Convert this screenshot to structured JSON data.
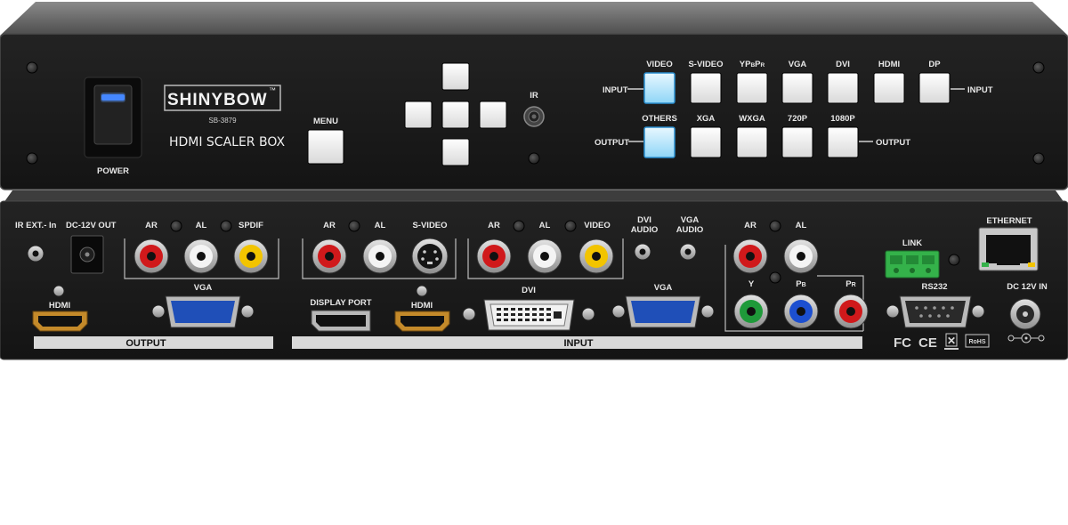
{
  "front": {
    "power_label": "POWER",
    "brand": "SHINYBOW",
    "brand_tm": "™",
    "model": "SB-3879",
    "product_name": "HDMI SCALER BOX",
    "menu_label": "MENU",
    "ir_label": "IR",
    "input_row": {
      "left_label": "INPUT",
      "right_label": "INPUT",
      "buttons": [
        "VIDEO",
        "S-VIDEO",
        "YPBPR",
        "VGA",
        "DVI",
        "HDMI",
        "DP"
      ],
      "ypbpr": {
        "y": "YP",
        "b": "B",
        "p": "P",
        "r": "R"
      },
      "active": "VIDEO"
    },
    "output_row": {
      "left_label": "OUTPUT",
      "right_label": "OUTPUT",
      "buttons": [
        "OTHERS",
        "XGA",
        "WXGA",
        "720P",
        "1080P"
      ],
      "active": "OTHERS"
    }
  },
  "rear": {
    "ir_ext": "IR EXT.- In",
    "dc_out": "DC-12V OUT",
    "out_audio": [
      "AR",
      "AL",
      "SPDIF"
    ],
    "out_hdmi": "HDMI",
    "out_vga": "VGA",
    "in_audio1": [
      "AR",
      "AL"
    ],
    "s_video": "S-VIDEO",
    "display_port": "DISPLAY PORT",
    "in_hdmi": "HDMI",
    "in_audio2": [
      "AR",
      "AL",
      "VIDEO"
    ],
    "dvi": "DVI",
    "dvi_audio": [
      "DVI",
      "AUDIO"
    ],
    "vga_audio": [
      "VGA",
      "AUDIO"
    ],
    "in_vga": "VGA",
    "component_audio": [
      "AR",
      "AL"
    ],
    "component": {
      "y": "Y",
      "pb_p": "P",
      "pb_sub": "B",
      "pr_p": "P",
      "pr_sub": "R"
    },
    "link": "LINK",
    "rs232": "RS232",
    "ethernet": "ETHERNET",
    "dc_in": "DC 12V IN",
    "output_bar": "OUTPUT",
    "input_bar": "INPUT",
    "certs": {
      "fc": "FC",
      "ce": "CE",
      "weee": "✕",
      "rohs": "RoHS"
    }
  },
  "colors": {
    "panel": "#1b1b1b",
    "chassis_top": "#6e6e6e",
    "button_white": "#f2f2f2",
    "button_active": "#bfe9ff",
    "power_led": "#3a7dff",
    "rca_red": "#d0191b",
    "rca_white": "#f4f4f4",
    "rca_yellow": "#f2c400",
    "rca_green": "#1f9a3a",
    "rca_blue": "#1c4fd0",
    "vga_blue": "#1f4fb8",
    "terminal_green": "#34b24a"
  }
}
